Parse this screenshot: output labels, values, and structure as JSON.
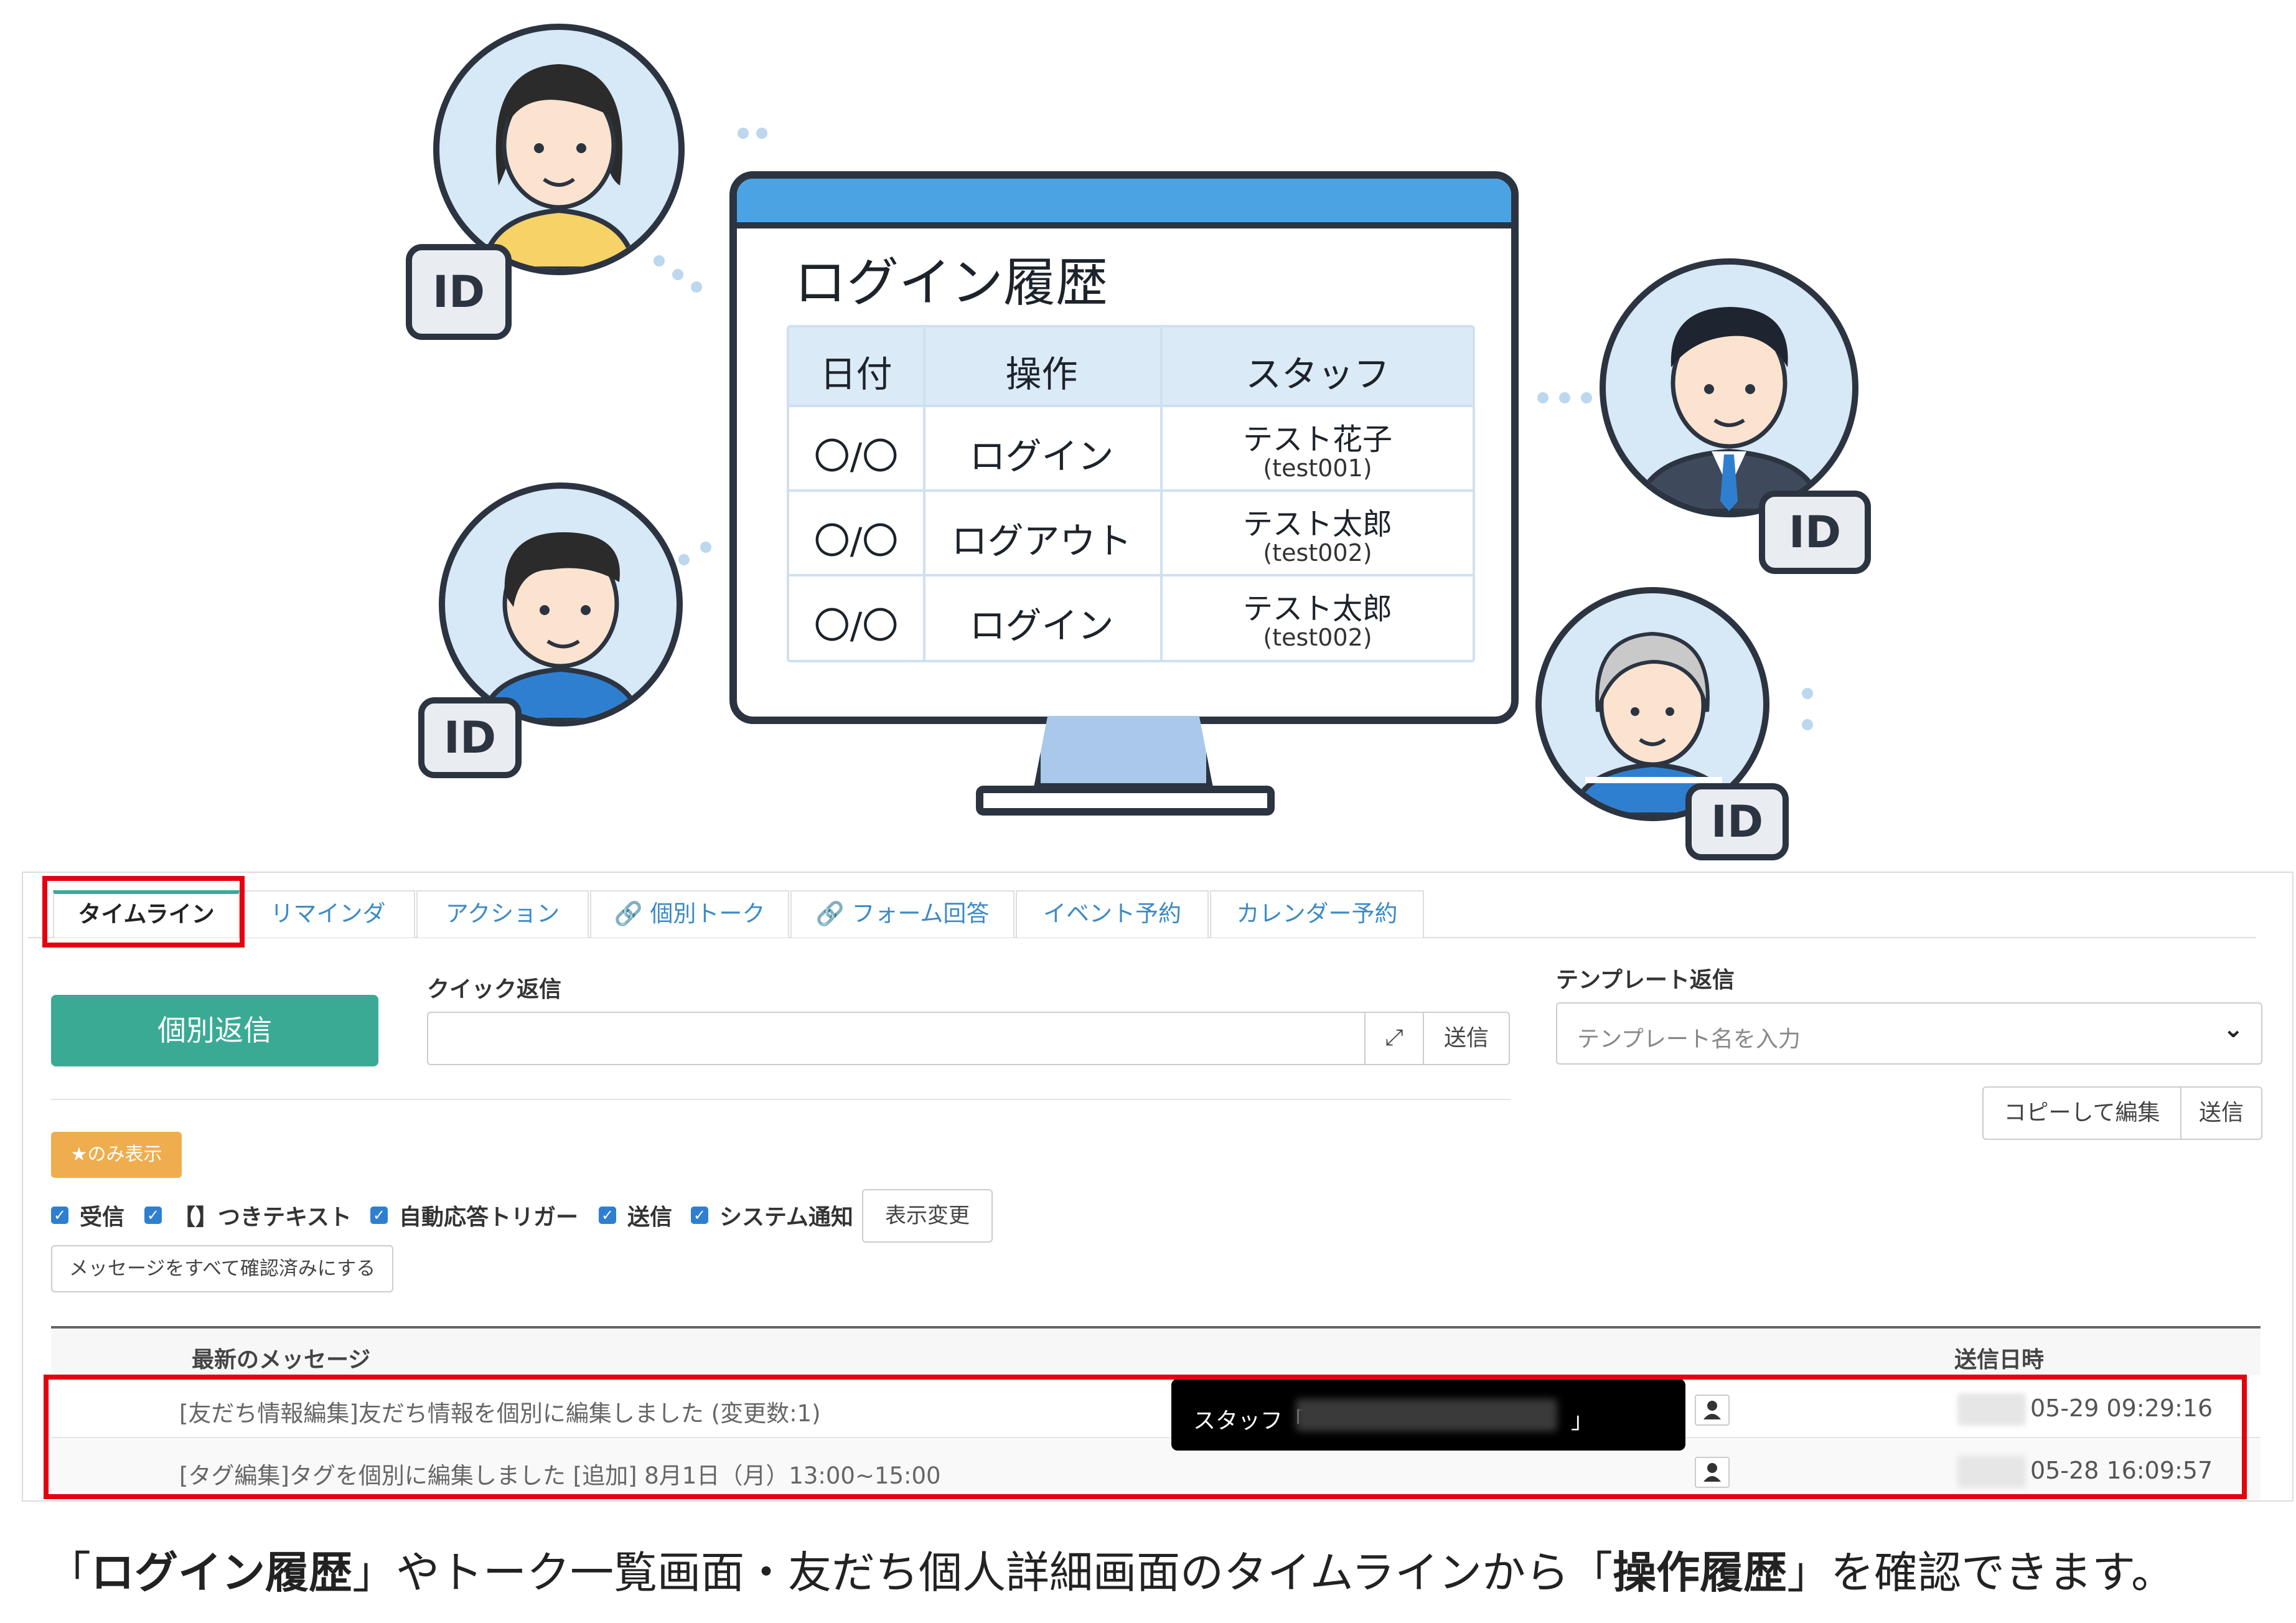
{
  "illustration": {
    "monitor_title": "ログイン履歴",
    "table": {
      "headers": [
        "日付",
        "操作",
        "スタッフ"
      ],
      "rows": [
        {
          "date": "〇/〇",
          "action": "ログイン",
          "staff_name": "テスト花子",
          "staff_id": "(test001)"
        },
        {
          "date": "〇/〇",
          "action": "ログアウト",
          "staff_name": "テスト太郎",
          "staff_id": "(test002)"
        },
        {
          "date": "〇/〇",
          "action": "ログイン",
          "staff_name": "テスト太郎",
          "staff_id": "(test002)"
        }
      ]
    },
    "id_badge": "ID",
    "colors": {
      "monitor_bar": "#4aa3e3",
      "table_header": "#dbeaf7",
      "outline": "#2b3440"
    }
  },
  "tabs": [
    {
      "label": "タイムライン",
      "active": true
    },
    {
      "label": "リマインダ"
    },
    {
      "label": "アクション"
    },
    {
      "label": "個別トーク",
      "icon": "link-icon"
    },
    {
      "label": "フォーム回答",
      "icon": "link-icon"
    },
    {
      "label": "イベント予約"
    },
    {
      "label": "カレンダー予約"
    }
  ],
  "reply": {
    "individual_reply_button": "個別返信",
    "quick_reply_label": "クイック返信",
    "quick_send_button": "送信",
    "template_label": "テンプレート返信",
    "template_placeholder": "テンプレート名を入力",
    "copy_edit_button": "コピーして編集",
    "template_send_button": "送信"
  },
  "filters": {
    "star_only_button": "★のみ表示",
    "checkboxes": [
      {
        "label": "受信",
        "checked": true
      },
      {
        "label": "【】つきテキスト",
        "checked": true
      },
      {
        "label": "自動応答トリガー",
        "checked": true
      },
      {
        "label": "送信",
        "checked": true
      },
      {
        "label": "システム通知",
        "checked": true
      }
    ],
    "apply_button": "表示変更",
    "mark_all_read_button": "メッセージをすべて確認済みにする"
  },
  "messages": {
    "header_message": "最新のメッセージ",
    "header_date": "送信日時",
    "rows": [
      {
        "text": "[友だち情報編集]友だち情報を個別に編集しました (変更数:1)",
        "date": "05-29 09:29:16"
      },
      {
        "text": "[タグ編集]タグを個別に編集しました [追加] 8月1日（月）13:00~15:00",
        "date": "05-28 16:09:57"
      }
    ],
    "tooltip_prefix": "スタッフ「",
    "tooltip_suffix": "」"
  },
  "caption": {
    "part1": "「",
    "bold1": "ログイン履歴",
    "part2": "」やトーク一覧画面・友だち個人詳細画面のタイムラインから「",
    "bold2": "操作履歴",
    "part3": "」を確認できます。"
  },
  "accent_colors": {
    "green": "#3aaa95",
    "orange": "#f0ad4e",
    "highlight_red": "#e3000f",
    "link_blue": "#3b8ac7"
  }
}
